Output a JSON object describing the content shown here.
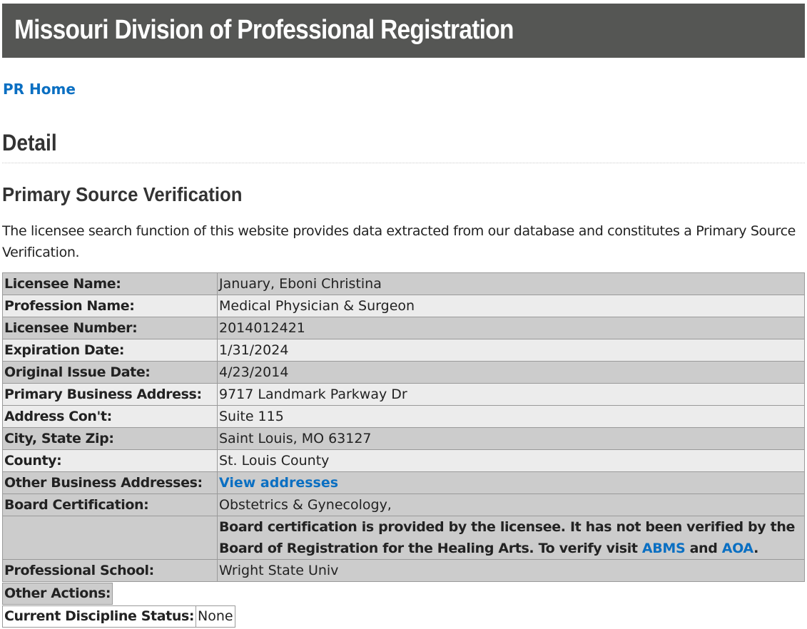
{
  "header": {
    "title": "Missouri Division of Professional Registration"
  },
  "nav": {
    "home_link": "PR Home"
  },
  "page": {
    "heading": "Detail",
    "section_heading": "Primary Source Verification",
    "intro": "The licensee search function of this website provides data extracted from our database and constitutes a Primary Source Verification."
  },
  "details": {
    "rows": [
      {
        "label": "Licensee Name:",
        "value": "January, Eboni Christina"
      },
      {
        "label": "Profession Name:",
        "value": "Medical Physician & Surgeon"
      },
      {
        "label": "Licensee Number:",
        "value": "2014012421"
      },
      {
        "label": "Expiration Date:",
        "value": "1/31/2024"
      },
      {
        "label": "Original Issue Date:",
        "value": "4/23/2014"
      },
      {
        "label": "Primary Business Address:",
        "value": "9717 Landmark Parkway Dr"
      },
      {
        "label": "Address Con't:",
        "value": "Suite 115"
      },
      {
        "label": "City, State Zip:",
        "value": "Saint Louis, MO 63127"
      },
      {
        "label": "County:",
        "value": "St. Louis County"
      }
    ],
    "other_addresses": {
      "label": "Other Business Addresses:",
      "link": "View addresses"
    },
    "board_certification": {
      "label": "Board Certification:",
      "value": "Obstetrics & Gynecology,"
    },
    "board_note": {
      "text": "Board certification is provided by the licensee. It has not been verified by the Board of Registration for the Healing Arts. To verify visit",
      "link1": "ABMS",
      "and": "and",
      "link2": "AOA",
      "end": "."
    },
    "professional_school": {
      "label": "Professional School:",
      "value": "Wright State Univ"
    },
    "other_actions": {
      "label": "Other Actions:"
    },
    "discipline": {
      "label": "Current Discipline Status:",
      "value": "None"
    }
  }
}
